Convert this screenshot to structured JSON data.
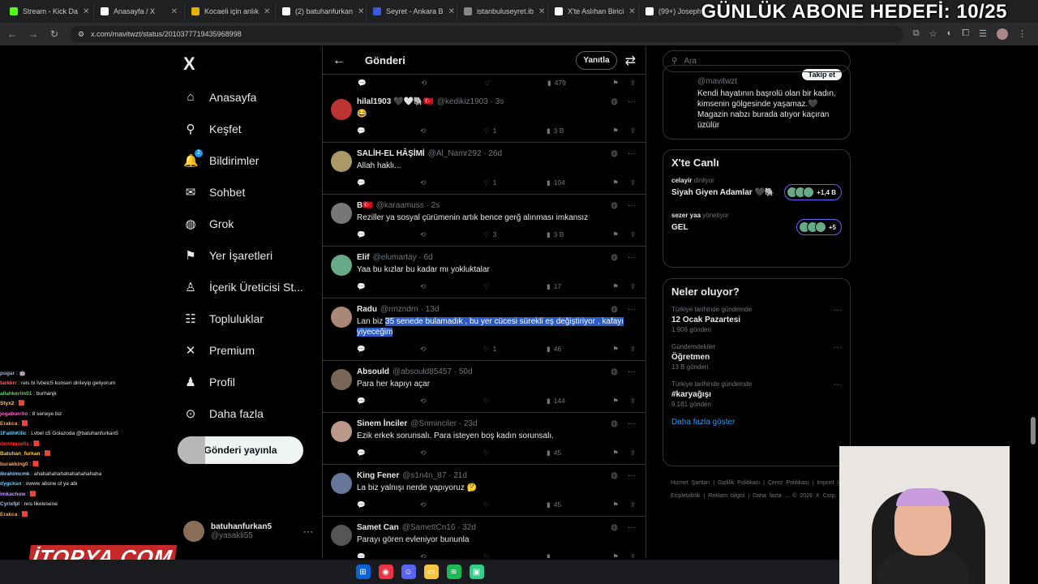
{
  "browser": {
    "tabs": [
      {
        "label": "Stream - Kick Da",
        "color": "#53fc18"
      },
      {
        "label": "Anasayfa / X",
        "color": "#ffffff"
      },
      {
        "label": "Kocaeli için anlık",
        "color": "#e4b400"
      },
      {
        "label": "(2) batuhanfurkan",
        "color": "#ffffff"
      },
      {
        "label": "Seyret - Ankara B",
        "color": "#3b5bdb"
      },
      {
        "label": "istanbuluseyret.ib",
        "color": "#888888"
      },
      {
        "label": "X'te Aslıhan Birici",
        "color": "#ffffff"
      },
      {
        "label": "(99+) Joseph",
        "color": "#ffffff"
      }
    ],
    "url": "x.com/mavitwzt/status/2010377719435968998"
  },
  "overlay": {
    "goal": "GÜNLÜK ABONE HEDEFİ: 10/25"
  },
  "nav": {
    "logo": "X",
    "items": [
      {
        "label": "Anasayfa",
        "icon": "home-icon",
        "glyph": "⌂"
      },
      {
        "label": "Keşfet",
        "icon": "search-icon",
        "glyph": "⚲"
      },
      {
        "label": "Bildirimler",
        "icon": "bell-icon",
        "glyph": "🔔",
        "badge": "2"
      },
      {
        "label": "Sohbet",
        "icon": "mail-icon",
        "glyph": "✉"
      },
      {
        "label": "Grok",
        "icon": "grok-icon",
        "glyph": "◍"
      },
      {
        "label": "Yer İşaretleri",
        "icon": "bookmark-icon",
        "glyph": "⚑"
      },
      {
        "label": "İçerik Üreticisi St...",
        "icon": "creator-icon",
        "glyph": "♙"
      },
      {
        "label": "Topluluklar",
        "icon": "communities-icon",
        "glyph": "☷"
      },
      {
        "label": "Premium",
        "icon": "premium-icon",
        "glyph": "✕"
      },
      {
        "label": "Profil",
        "icon": "profile-icon",
        "glyph": "♟"
      },
      {
        "label": "Daha fazla",
        "icon": "more-icon",
        "glyph": "⊙"
      }
    ],
    "post_button": "Gönderi yayınla",
    "account": {
      "name": "batuhanfurkan5",
      "handle": "@yasakli55"
    }
  },
  "feed": {
    "title": "Gönderi",
    "reply_button": "Yanıtla",
    "top_views": "479",
    "tweets": [
      {
        "name": "hilal1903 🖤🤍🐘🇹🇷",
        "handle": "@kedikiz1903 · 3s",
        "text": "😂",
        "likes": "1",
        "views": "3 B",
        "avatar": "#b33"
      },
      {
        "name": "SALİH-EL HÂŞİMİ",
        "handle": "@Al_Namr292 · 26d",
        "text": "Allah haklı...",
        "likes": "1",
        "views": "104",
        "avatar": "#a96"
      },
      {
        "name": "B🇹🇷",
        "handle": "@karaamuss · 2s",
        "text": "Reziller ya sosyal çürümenin artık bence gerğ alınması imkansız",
        "likes": "3",
        "views": "3 B",
        "avatar": "#777"
      },
      {
        "name": "Elif",
        "handle": "@elumartay · 6d",
        "text": "Yaa bu kızlar bu kadar mı yokluktalar",
        "likes": "",
        "views": "17",
        "avatar": "#6a8"
      },
      {
        "name": "Radu",
        "handle": "@rmzndrn · 13d",
        "text_plain": "Lan biz ",
        "text_sel": "35 senede bulamadık , bu yer cücesi sürekli eş değiştiriyor , kafayı yiyeceğim",
        "likes": "1",
        "views": "46",
        "avatar": "#a87"
      },
      {
        "name": "Absould",
        "handle": "@absould85457 · 50d",
        "text": "Para her kapıyı açar",
        "likes": "",
        "views": "144",
        "avatar": "#765"
      },
      {
        "name": "Sinem İnciler",
        "handle": "@Snminciler · 23d",
        "text": "Ezik erkek sorunsalı. Para isteyen boş kadın sorunsalı.",
        "likes": "",
        "views": "45",
        "avatar": "#b98"
      },
      {
        "name": "King Fener",
        "handle": "@s1n4n_87 · 21d",
        "text": "La biz yalnışı nerde yapıyoruz 🤔",
        "likes": "",
        "views": "45",
        "avatar": "#679"
      },
      {
        "name": "Samet Can",
        "handle": "@SamettCn16 · 32d",
        "text": "Parayı gören evleniyor bununla",
        "likes": "",
        "views": "",
        "avatar": "#555"
      }
    ]
  },
  "right": {
    "search_placeholder": "Ara",
    "profile": {
      "handle": "@mavitwzt",
      "follow": "Takip et",
      "bio": "Kendi hayatının başrolü olan bir kadın, kimsenin gölgesinde yaşamaz.🖤 Magazin nabzı burada atıyor kaçıran üzülür"
    },
    "live": {
      "title": "X'te Canlı",
      "items": [
        {
          "who": "celayir",
          "role": "dinliyor",
          "title": "Siyah Giyen Adamlar 🖤🐘",
          "count": "+1,4 B"
        },
        {
          "who": "sezer yaa",
          "role": "yönetiyor",
          "title": "GEL",
          "count": "+5"
        }
      ]
    },
    "trends": {
      "title": "Neler oluyor?",
      "items": [
        {
          "context": "Türkiye tarihinde gündemde",
          "name": "12 Ocak Pazartesi",
          "count": "1.906 gönderi"
        },
        {
          "context": "Gündemdekiler",
          "name": "Öğretmen",
          "count": "13 B gönderi"
        },
        {
          "context": "Türkiye tarihinde gündemde",
          "name": "#karyağışı",
          "count": "9.181 gönderi"
        }
      ],
      "more": "Daha fazla göster"
    },
    "footer": "Hizmet Şartları | Gizlilik Politikası | Çerez Politikası | Imprint | Erişilebilirlik | Reklam bilgisi | Daha fazla ... © 2026 X Corp."
  },
  "chat": [
    {
      "user": "pugar",
      "msg": "🤖",
      "color": "#9bd"
    },
    {
      "user": "tarkkrr",
      "msg": "reis bi İvbelc5 konseri dinleyip geliyorum",
      "color": "#f66"
    },
    {
      "user": "allahkerim01",
      "msg": "burhanjk",
      "color": "#6c6"
    },
    {
      "user": "Styx2",
      "msg": "🟥",
      "color": "#fc6"
    },
    {
      "user": "jogaburrito",
      "msg": "8 seneye biz",
      "color": "#f6c"
    },
    {
      "user": "Erakca",
      "msg": "🟥",
      "color": "#fa3"
    },
    {
      "user": "1FatihKilic",
      "msg": "Lvbel c5 Golazoda @batuhanfurkan5",
      "color": "#6cf"
    },
    {
      "user": "devrimselis",
      "msg": "🟥",
      "color": "#f33"
    },
    {
      "user": "Batuhan_furkan",
      "msg": "🟥",
      "color": "#fc3"
    },
    {
      "user": "burakking0",
      "msg": "🟥",
      "color": "#fa6"
    },
    {
      "user": "ibrahimcmk",
      "msg": "ahahahahahahahahahahaha",
      "color": "#9cf"
    },
    {
      "user": "dygcksn",
      "msg": "owww abone ol ya abi",
      "color": "#6cf"
    },
    {
      "user": "imkachow",
      "msg": "🟥",
      "color": "#c9f"
    },
    {
      "user": "Cyrixfpl",
      "msg": "reis likelesene",
      "color": "#9cf"
    },
    {
      "user": "Erakca",
      "msg": "🟥",
      "color": "#fa3"
    }
  ],
  "sponsor": "İTOPYA.COM"
}
